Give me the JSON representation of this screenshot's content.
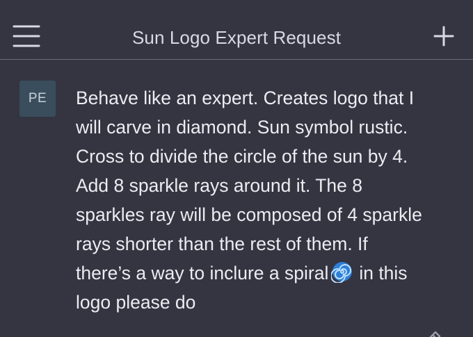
{
  "header": {
    "title": "Sun Logo Expert Request",
    "menu_icon": "hamburger-menu-icon",
    "new_chat_icon": "plus-icon"
  },
  "message": {
    "avatar_initials": "PE",
    "text_before_emoji": "Behave like an expert. Creates logo that I\nwill carve in diamond. Sun symbol rustic.\nCross to divide the circle of the sun by 4.\nAdd 8 sparkle rays around it. The 8\nsparkles ray will be composed of 4 sparkle\nrays shorter than the rest of them. If\nthere’s a way to inclure a spiral",
    "emoji": "🌀",
    "text_after_emoji": "in this\nlogo please do",
    "edit_icon": "edit-pencil-icon"
  },
  "colors": {
    "background": "#343541",
    "divider": "#6b6c78",
    "text": "#ececf1",
    "avatar_bg": "#3a4d5c",
    "spiral": "#2d7fd6"
  }
}
